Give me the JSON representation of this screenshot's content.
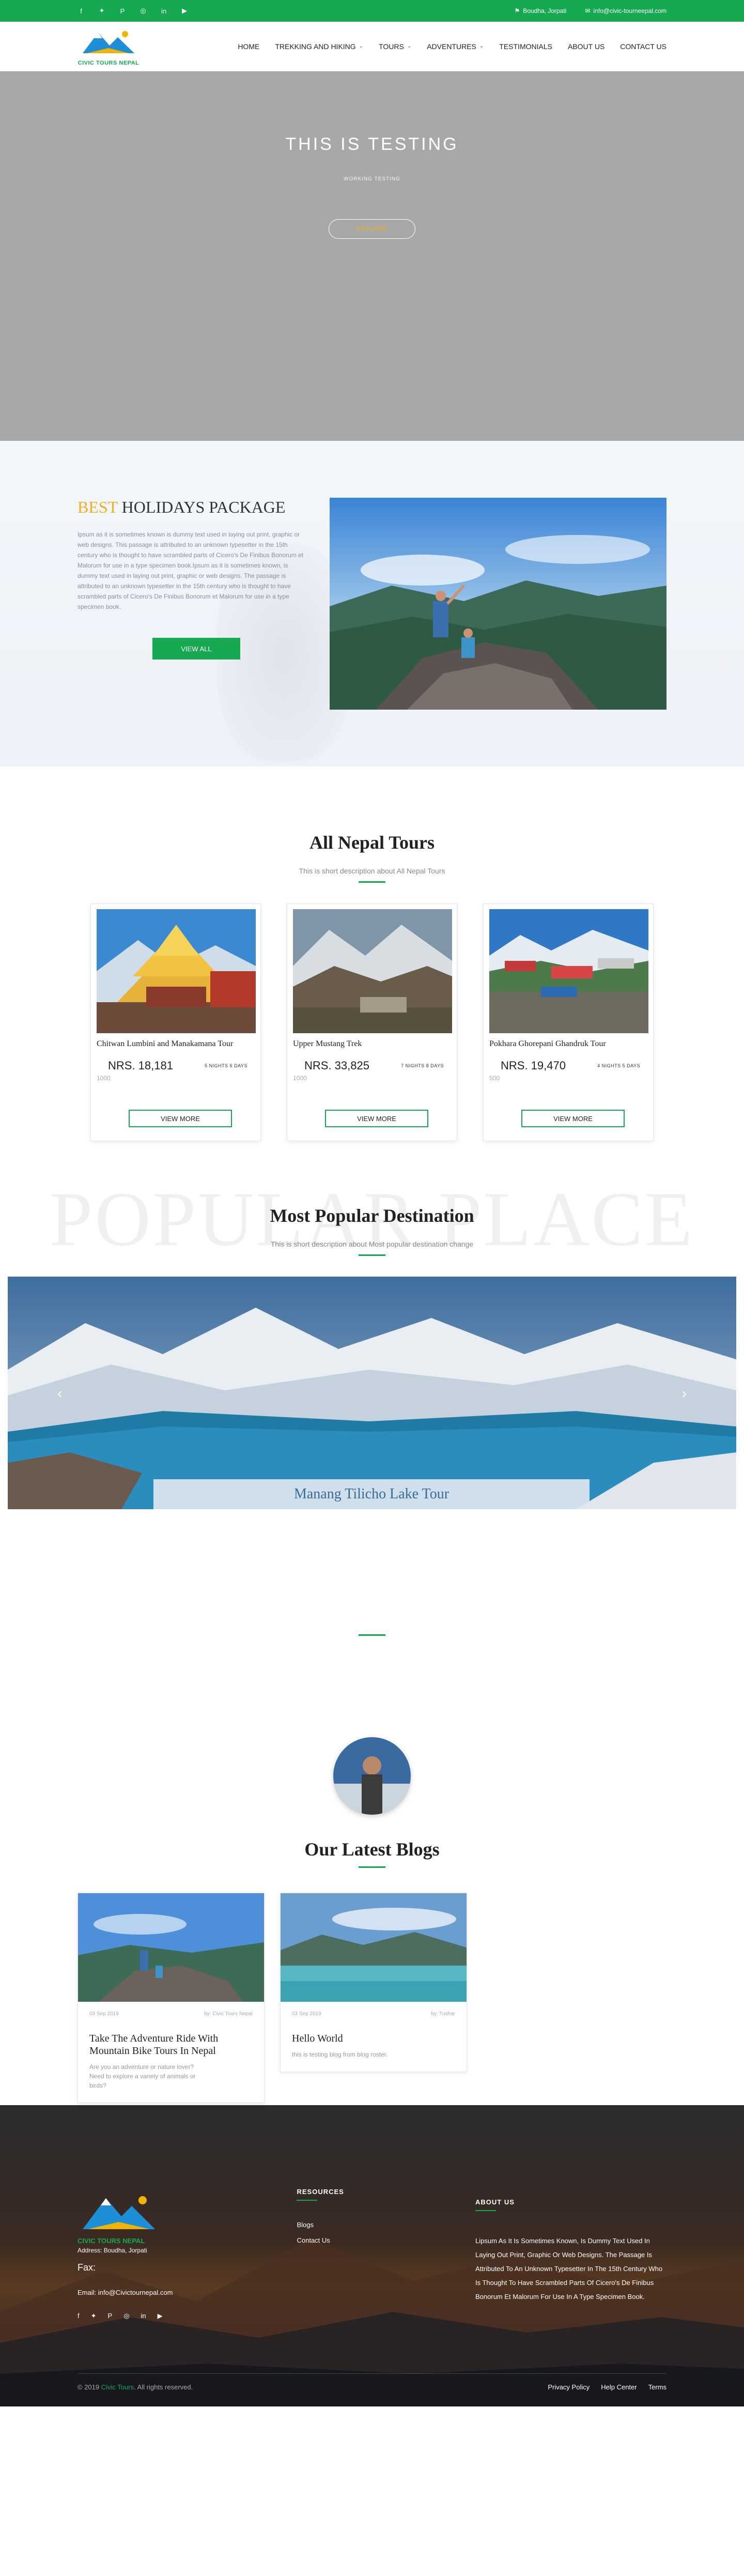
{
  "topbar": {
    "socials": [
      {
        "icon": "facebook-icon",
        "glyph": "f"
      },
      {
        "icon": "twitter-icon",
        "glyph": "🐦"
      },
      {
        "icon": "pinterest-icon",
        "glyph": "P"
      },
      {
        "icon": "instagram-icon",
        "glyph": "◎"
      },
      {
        "icon": "linkedin-icon",
        "glyph": "in"
      },
      {
        "icon": "youtube-icon",
        "glyph": "▶"
      }
    ],
    "address": "Boudha, Jorpati",
    "email": "info@civic-tourneepal.com",
    "color": "#16a952"
  },
  "header": {
    "logo_text": "CIVIC TOURS NEPAL",
    "nav": [
      "HOME",
      "TREKKING AND HIKING",
      "TOURS",
      "ADVENTURES",
      "TESTIMONIALS",
      "ABOUT US",
      "CONTACT US"
    ]
  },
  "hero": {
    "title": "THIS IS TESTING",
    "subtitle": "WORKING TESTING",
    "button": "EXPLORE"
  },
  "holiday": {
    "title_accent": "BEST",
    "title_rest": " HOLIDAYS PACKAGE",
    "body": "Ipsum as it is sometimes known is dummy text used in laying out print, graphic or web designs. This passage is attributed to an unknown typesetter in the 15th century who is thought to have scrambled parts of Cicero's De Finibus Bonorum et Malorum for use in a type specimen book.Ipsum as it is sometimes known, is dummy text used in laying out print, graphic or web designs. The passage is attributed to an unknown typesetter in the 15th century who is thought to have scrambled parts of Cicero's De Finibus Bonorum et Malorum for use in a type specimen book.",
    "button": "VIEW ALL"
  },
  "tours": {
    "title": "All Nepal Tours",
    "subtitle": "This is short description about All Nepal Tours",
    "cards": [
      {
        "title": "Chitwan Lumbini and Manakamana Tour",
        "price": "NRS. 18,181",
        "nights": "5 NIGHTS 6 DAYS",
        "old": "1000",
        "button": "VIEW MORE"
      },
      {
        "title": "Upper Mustang Trek",
        "price": "NRS. 33,825",
        "nights": "7 NIGHTS 8 DAYS",
        "old": "1000",
        "button": "VIEW MORE"
      },
      {
        "title": "Pokhara Ghorepani Ghandruk Tour",
        "price": "NRS. 19,470",
        "nights": "4 NIGHTS 5 DAYS",
        "old": "500",
        "button": "VIEW MORE"
      }
    ]
  },
  "popular": {
    "bg_text": "POPULAR PLACE",
    "title": "Most Popular Destination",
    "subtitle": "This is short description about Most popular destination change",
    "caption": "Manang Tilicho Lake Tour",
    "prev": "‹",
    "next": "›"
  },
  "blogs": {
    "title": "Our Latest Blogs",
    "items": [
      {
        "date": "03 Sep 2019",
        "author": "by: Civic Tours Nepal",
        "title": "Take The Adventure Ride With Mountain Bike Tours In Nepal",
        "desc": "Are you an adventure or nature lover? Need to explore a variety of animals or birds?"
      },
      {
        "date": "03 Sep 2019",
        "author": "by: Tushar",
        "title": "Hello World",
        "desc": "this is testing blog from blog roster."
      }
    ]
  },
  "footer": {
    "logo_text": "CIVIC TOURS NEPAL",
    "address": "Address: Boudha, Jorpati",
    "fax": "Fax:",
    "email": "Email: info@Civictournepal.com",
    "resources_title": "RESOURCES",
    "links": [
      "Blogs",
      "Contact Us"
    ],
    "about_title": "ABOUT US",
    "about": "Lipsum As It Is Sometimes Known, Is Dummy Text Used In Laying Out Print, Graphic Or Web Designs. The Passage Is Attributed To An Unknown Typesetter In The 15th Century Who Is Thought To Have Scrambled Parts Of Cicero's De Finibus Bonorum Et Malorum For Use In A Type Specimen Book.",
    "copy_prefix": "© 2019 ",
    "copy_brand": "Civic Tours",
    "copy_suffix": ". All rights reserved.",
    "bottom_links": [
      "Privacy Policy",
      "Help Center",
      "Terms"
    ]
  }
}
